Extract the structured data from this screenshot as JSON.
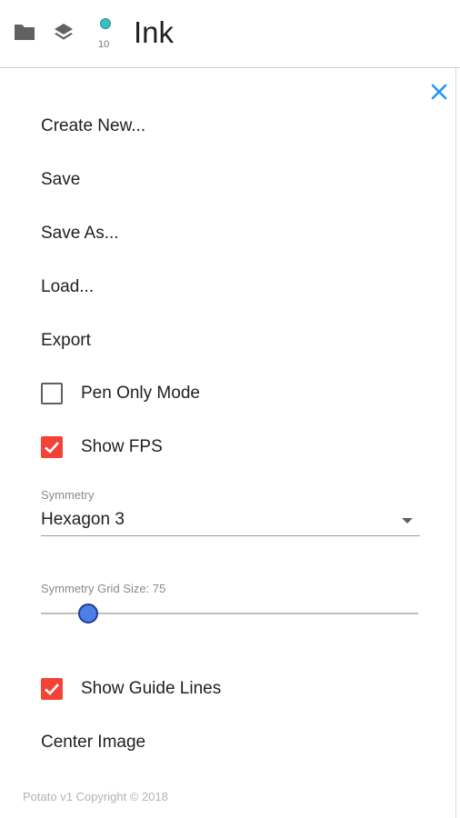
{
  "toolbar": {
    "folder_icon": "folder-icon",
    "layers_icon": "layers-icon",
    "brush_color": "#3dbfbf",
    "brush_size": "10",
    "title": "Ink"
  },
  "menu": {
    "close_icon": "close-icon",
    "items": [
      {
        "label": "Create New..."
      },
      {
        "label": "Save"
      },
      {
        "label": "Save As..."
      },
      {
        "label": "Load..."
      },
      {
        "label": "Export"
      }
    ],
    "pen_only_mode": {
      "label": "Pen Only Mode",
      "checked": false
    },
    "show_fps": {
      "label": "Show FPS",
      "checked": true
    },
    "symmetry": {
      "label": "Symmetry",
      "value": "Hexagon 3"
    },
    "grid_size": {
      "label": "Symmetry Grid Size: 75",
      "value": 75,
      "fraction": 0.125
    },
    "show_guide_lines": {
      "label": "Show Guide Lines",
      "checked": true
    },
    "center_image": {
      "label": "Center Image"
    }
  },
  "footer": {
    "copyright": "Potato v1 Copyright © 2018"
  },
  "colors": {
    "accent": "#f44336",
    "close": "#2196f3",
    "slider_thumb": "#4d7fe8"
  }
}
